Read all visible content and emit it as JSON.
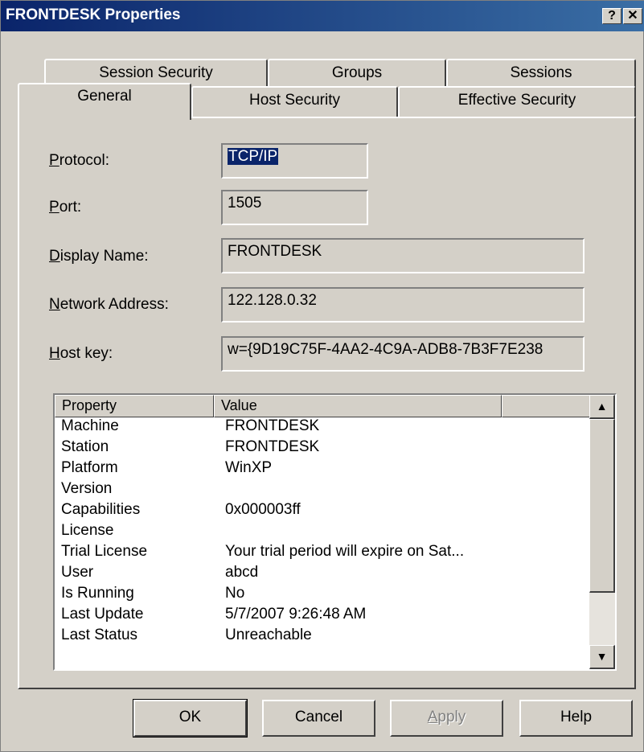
{
  "window": {
    "title": "FRONTDESK Properties",
    "help_button": "?",
    "close_button": "✕"
  },
  "tabs": {
    "back_row": [
      "Session Security",
      "Groups",
      "Sessions"
    ],
    "front_row": [
      "General",
      "Host Security",
      "Effective Security"
    ],
    "active": "General"
  },
  "fields": {
    "protocol": {
      "label_u": "P",
      "label_rest": "rotocol:",
      "value": "TCP/IP"
    },
    "port": {
      "label_u": "P",
      "label_rest": "ort:",
      "value": "1505"
    },
    "display_name": {
      "label_u": "D",
      "label_rest": "isplay Name:",
      "value": "FRONTDESK"
    },
    "network_address": {
      "label_u": "N",
      "label_rest": "etwork Address:",
      "value": "122.128.0.32"
    },
    "host_key": {
      "label_u": "H",
      "label_rest": "ost key:",
      "value": "w={9D19C75F-4AA2-4C9A-ADB8-7B3F7E238"
    }
  },
  "list": {
    "columns": [
      "Property",
      "Value",
      ""
    ],
    "rows": [
      [
        "Machine",
        "FRONTDESK"
      ],
      [
        "Station",
        "FRONTDESK"
      ],
      [
        "Platform",
        "WinXP"
      ],
      [
        "Version",
        ""
      ],
      [
        "Capabilities",
        "0x000003ff"
      ],
      [
        "License",
        ""
      ],
      [
        "Trial License",
        "Your trial period will expire on Sat..."
      ],
      [
        "User",
        "abcd"
      ],
      [
        "Is Running",
        "No"
      ],
      [
        "Last Update",
        "5/7/2007 9:26:48 AM"
      ],
      [
        "Last Status",
        "Unreachable"
      ]
    ],
    "scroll_up": "▲",
    "scroll_down": "▼"
  },
  "buttons": {
    "ok": "OK",
    "cancel": "Cancel",
    "apply_u": "A",
    "apply_rest": "pply",
    "help": "Help"
  }
}
